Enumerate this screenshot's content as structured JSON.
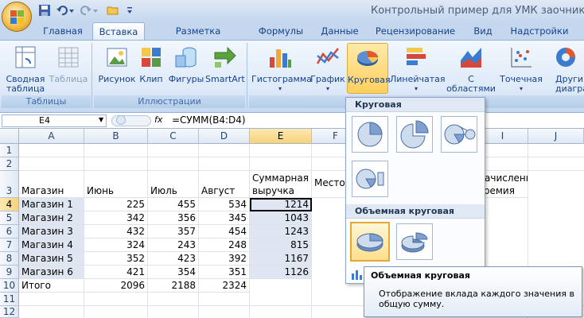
{
  "window": {
    "title": "Контрольный пример для УМК заочники - М"
  },
  "tabs": [
    {
      "label": "Главная"
    },
    {
      "label": "Вставка"
    },
    {
      "label": "Разметка страницы"
    },
    {
      "label": "Формулы"
    },
    {
      "label": "Данные"
    },
    {
      "label": "Рецензирование"
    },
    {
      "label": "Вид"
    },
    {
      "label": "Надстройки"
    }
  ],
  "ribbon": {
    "groups": {
      "tables": "Таблицы",
      "illustrations": "Иллюстрации"
    },
    "pivot": {
      "line1": "Сводная",
      "line2": "таблица"
    },
    "table": "Таблица",
    "picture": "Рисунок",
    "clip": "Клип",
    "shapes": "Фигуры",
    "smartart": "SmartArt",
    "histogram": "Гистограмма",
    "graph": "График",
    "pie": "Круговая",
    "bar": "Линейчатая",
    "area": {
      "line1": "С",
      "line2": "областями"
    },
    "scatter": "Точечная",
    "other": {
      "line1": "Други",
      "line2": "диаграмм"
    }
  },
  "formula_bar": {
    "cell": "E4",
    "fx": "fx",
    "formula": "=СУММ(B4:D4)"
  },
  "columns": [
    "A",
    "B",
    "C",
    "D",
    "E",
    "F",
    "I",
    "J"
  ],
  "rows": [
    "1",
    "2",
    "3",
    "4",
    "5",
    "6",
    "7",
    "8",
    "9",
    "10",
    "11",
    "12"
  ],
  "sheet": {
    "r3": {
      "a": "Магазин",
      "b": "Июнь",
      "c": "Июль",
      "d": "Август",
      "e1": "Суммарная",
      "e2": "выручка",
      "f": "Место",
      "i1": "Начисленная",
      "i2": "премия"
    },
    "data": [
      [
        "Магазин 1",
        "225",
        "455",
        "534",
        "1214"
      ],
      [
        "Магазин 2",
        "342",
        "356",
        "345",
        "1043"
      ],
      [
        "Магазин 3",
        "432",
        "357",
        "454",
        "1243"
      ],
      [
        "Магазин 4",
        "324",
        "243",
        "248",
        "815"
      ],
      [
        "Магазин 5",
        "352",
        "423",
        "392",
        "1167"
      ],
      [
        "Магазин 6",
        "421",
        "354",
        "351",
        "1126"
      ]
    ],
    "total": [
      "Итого",
      "2096",
      "2188",
      "2324"
    ]
  },
  "dropdown": {
    "section1": "Круговая",
    "section2": "Объемная круговая"
  },
  "tooltip": {
    "title": "Объемная круговая",
    "text": "Отображение вклада каждого значения в общую сумму."
  }
}
